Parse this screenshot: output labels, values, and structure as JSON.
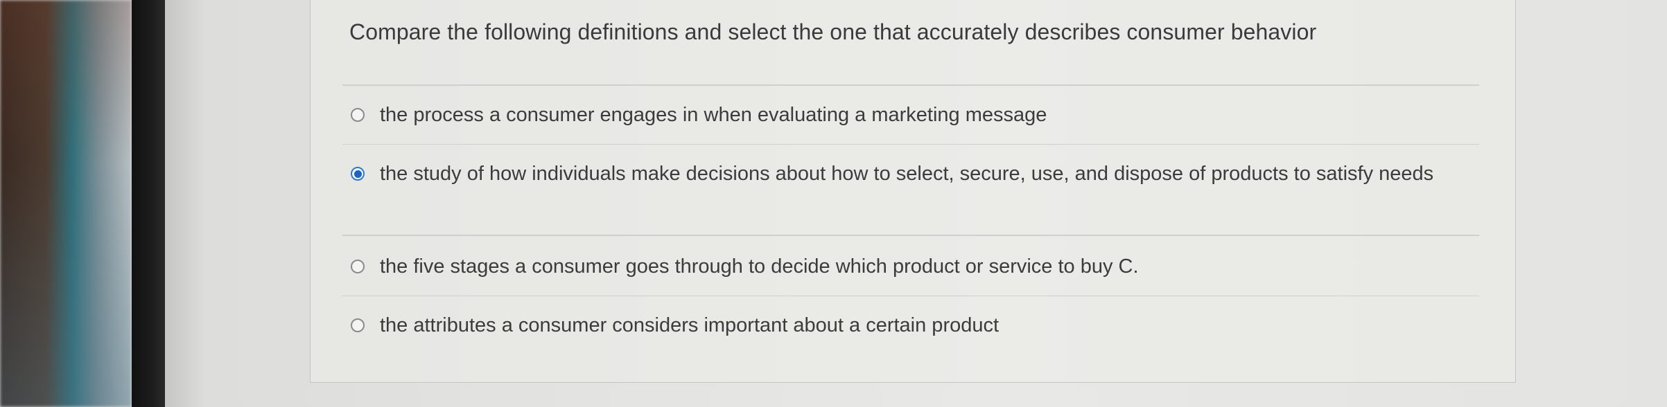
{
  "question": {
    "prompt": "Compare the following definitions and select the one that accurately describes consumer behavior",
    "selected_index": 1,
    "options": [
      {
        "label": "the process a consumer engages in when evaluating a marketing message",
        "selected": false
      },
      {
        "label": "the study of how individuals make decisions about how to select, secure, use, and dispose of products to satisfy needs",
        "selected": true
      },
      {
        "label": "the five stages a consumer goes through to decide which product or service to buy C.",
        "selected": false
      },
      {
        "label": "the attributes a consumer considers important about a certain product",
        "selected": false
      }
    ]
  },
  "colors": {
    "selected_radio": "#1d64c2",
    "text": "#3b3b3b"
  }
}
